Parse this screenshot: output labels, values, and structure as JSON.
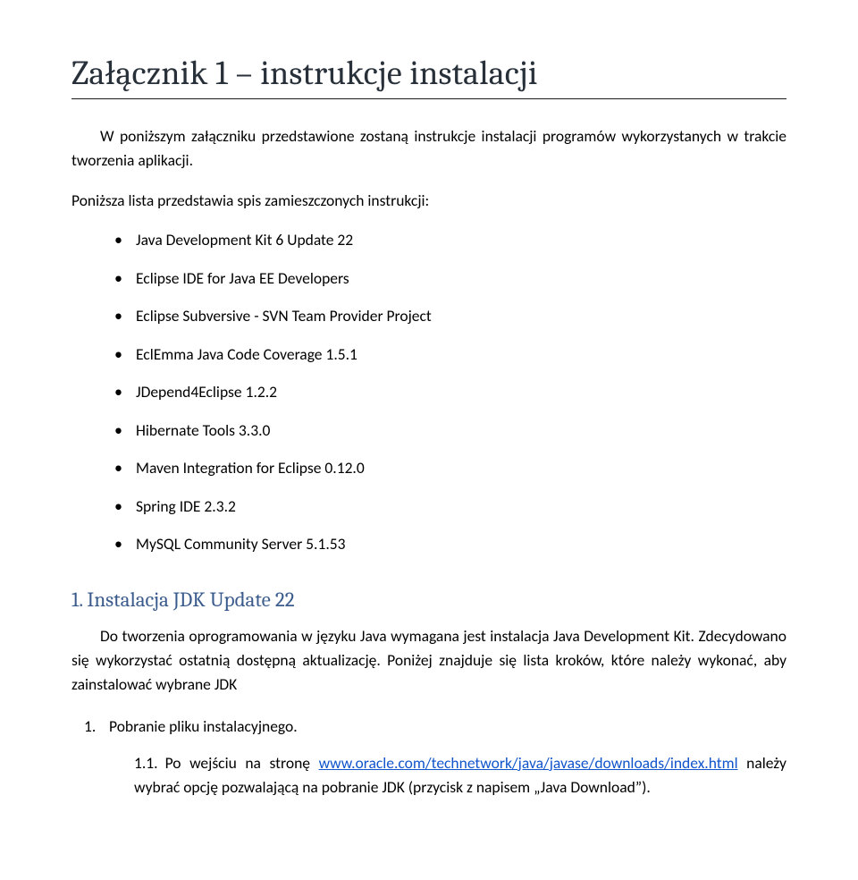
{
  "title": "Załącznik 1 – instrukcje instalacji",
  "intro1": "W poniższym załączniku przedstawione zostaną instrukcje instalacji programów wykorzystanych w trakcie tworzenia aplikacji.",
  "intro2": "Poniższa lista przedstawia spis zamieszczonych instrukcji:",
  "bullets": [
    "Java Development Kit 6 Update 22",
    "Eclipse IDE for Java EE Developers",
    "Eclipse Subversive - SVN Team Provider Project",
    "EclEmma Java Code Coverage 1.5.1",
    "JDepend4Eclipse 1.2.2",
    "Hibernate Tools 3.3.0",
    "Maven Integration for Eclipse 0.12.0",
    "Spring IDE 2.3.2",
    "MySQL Community Server  5.1.53"
  ],
  "section1": {
    "heading": "1.  Instalacja JDK Update 22",
    "p1_a": "Do tworzenia oprogramowania w języku Java wymagana jest instalacja Java Development Kit. Zdecydowano się wykorzystać ostatnią dostępną aktualizację. Poniżej znajduje się lista kroków, które należy wykonać, aby zainstalować wybrane JDK",
    "step1": "Pobranie pliku instalacyjnego.",
    "sub_num": "1.1.",
    "sub_a": "Po wejściu na stronę ",
    "sub_link": "www.oracle.com/technetwork/java/javase/downloads/index.html",
    "sub_b": " należy wybrać opcję pozwalającą na pobranie JDK (przycisk z napisem „Java Download”)."
  }
}
